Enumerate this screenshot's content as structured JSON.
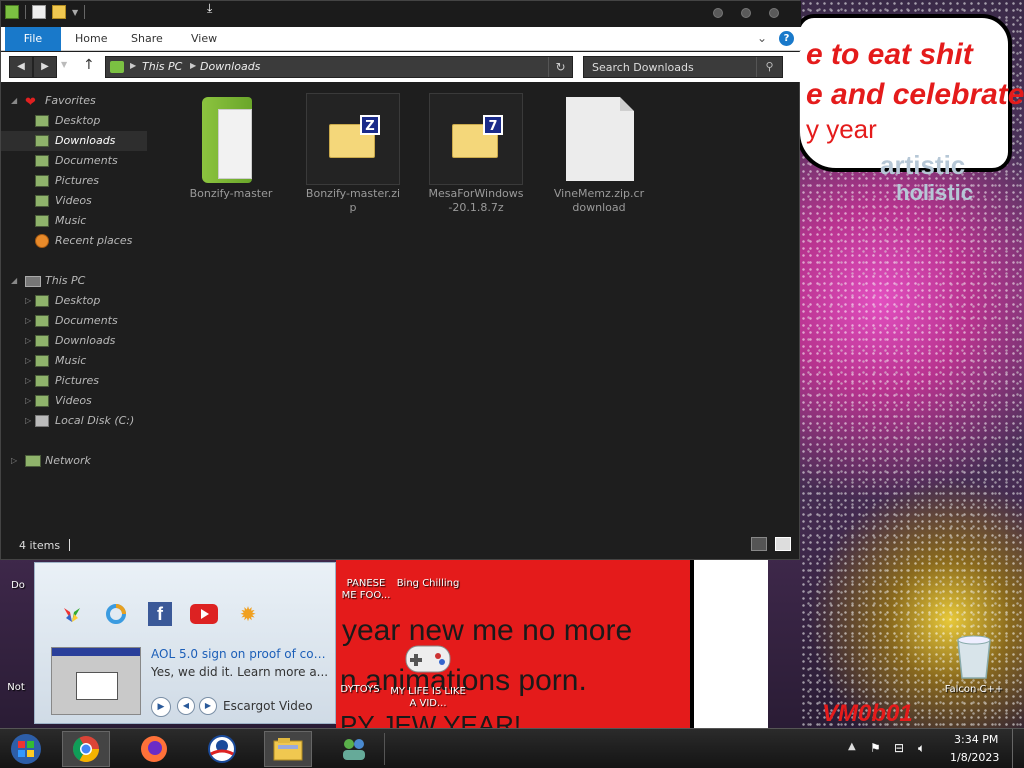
{
  "explorer": {
    "ribbon": {
      "file": "File",
      "home": "Home",
      "share": "Share",
      "view": "View"
    },
    "address": {
      "root": "This PC",
      "current": "Downloads"
    },
    "search_placeholder": "Search Downloads",
    "nav": {
      "favorites": "Favorites",
      "favorites_items": [
        "Desktop",
        "Downloads",
        "Documents",
        "Pictures",
        "Videos",
        "Music",
        "Recent places"
      ],
      "this_pc": "This PC",
      "pc_items": [
        "Desktop",
        "Documents",
        "Downloads",
        "Music",
        "Pictures",
        "Videos",
        "Local Disk (C:)"
      ],
      "network": "Network"
    },
    "files": [
      {
        "name": "Bonzify-master",
        "badge": ""
      },
      {
        "name": "Bonzify-master.zip",
        "badge": "Z"
      },
      {
        "name": "MesaForWindows-20.1.8.7z",
        "badge": "7"
      },
      {
        "name": "VineMemz.zip.crdownload",
        "badge": ""
      }
    ],
    "status": "4 items"
  },
  "wallpaper": {
    "speech_line1": "e to eat shit",
    "speech_line2": "e and celebrate",
    "speech_line3": "y year",
    "text_line1": "year new me no more",
    "text_line2": "n animations porn.",
    "text_line3": "PY JEW YEAR!",
    "art1": "artistic",
    "art2": "holistic",
    "vmobot": "VM0b01"
  },
  "desktop_icons": {
    "japanese": "PANESE\nME FOO...",
    "bing": "Bing Chilling",
    "toys": "DYTOYS",
    "mylife": "MY LIFE IS LIKE A VID...",
    "falcon": "Falcon C++",
    "not": "Not",
    "do": "Do"
  },
  "widget": {
    "title": "AOL 5.0 sign on proof of con...",
    "subtitle": "Yes, we did it. Learn more a...",
    "video_label": "Escargot Video"
  },
  "taskbar": {
    "time": "3:34 PM",
    "date": "1/8/2023"
  },
  "colors": {
    "accent": "#1979ca",
    "explorer_bg": "#1e1e1e",
    "folder_green": "#7bc042"
  }
}
